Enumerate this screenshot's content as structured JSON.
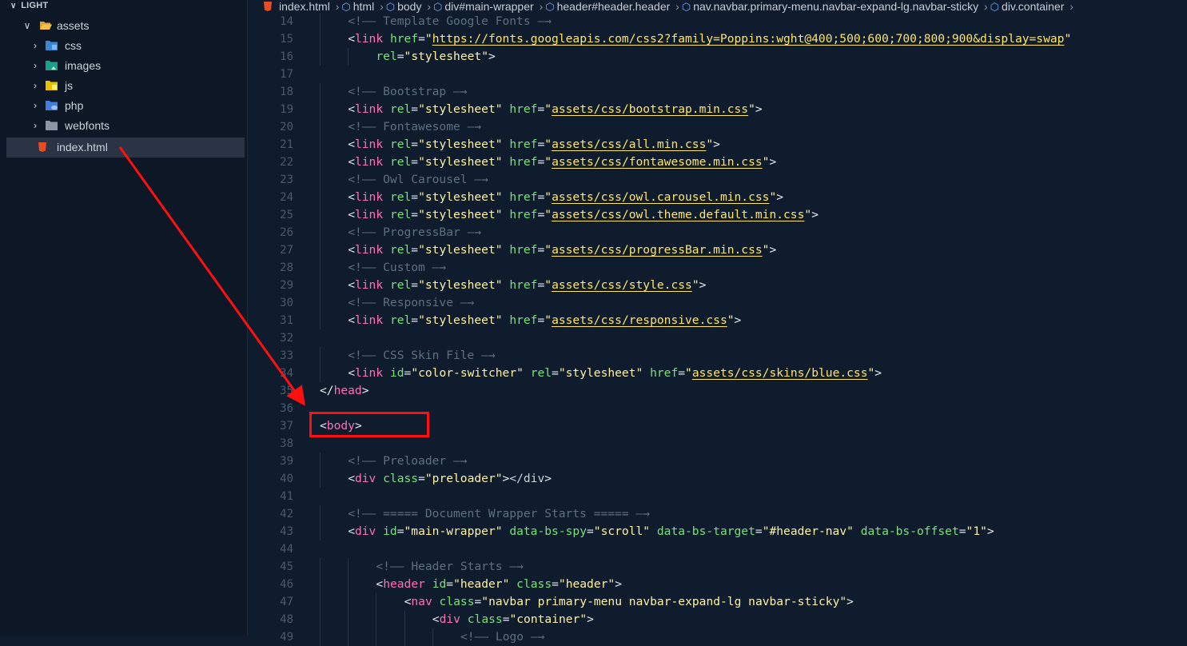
{
  "sidebar": {
    "title": "LIGHT",
    "items": [
      {
        "label": "assets",
        "icon": "folder-open-icon",
        "expanded": true
      },
      {
        "label": "css",
        "icon": "css-folder-icon"
      },
      {
        "label": "images",
        "icon": "images-folder-icon"
      },
      {
        "label": "js",
        "icon": "js-folder-icon"
      },
      {
        "label": "php",
        "icon": "php-folder-icon"
      },
      {
        "label": "webfonts",
        "icon": "folder-icon"
      },
      {
        "label": "index.html",
        "icon": "html5-icon",
        "selected": true
      }
    ]
  },
  "breadcrumb": {
    "file": "index.html",
    "items": [
      "html",
      "body",
      "div#main-wrapper",
      "header#header.header",
      "nav.navbar.primary-menu.navbar-expand-lg.navbar-sticky",
      "div.container"
    ]
  },
  "colors": {
    "background": "#0f1c2e",
    "sidebar_bg": "#0d1726",
    "tag": "#ff6fb5",
    "attribute": "#7be07b",
    "string": "#fff3a6",
    "comment": "#5c7080",
    "annotation": "#ff1010"
  },
  "editor": {
    "lines": [
      {
        "n": "14",
        "code": "<!-- Template Google Fonts -->"
      },
      {
        "n": "15",
        "code": "<link href=\"https://fonts.googleapis.com/css2?family=Poppins:wght@400;500;600;700;800;900&display=swap\""
      },
      {
        "n": "16",
        "code": "rel=\"stylesheet\">"
      },
      {
        "n": "17",
        "code": ""
      },
      {
        "n": "18",
        "code": "<!-- Bootstrap -->"
      },
      {
        "n": "19",
        "code": "<link rel=\"stylesheet\" href=\"assets/css/bootstrap.min.css\">"
      },
      {
        "n": "20",
        "code": "<!-- Fontawesome -->"
      },
      {
        "n": "21",
        "code": "<link rel=\"stylesheet\" href=\"assets/css/all.min.css\">"
      },
      {
        "n": "22",
        "code": "<link rel=\"stylesheet\" href=\"assets/css/fontawesome.min.css\">"
      },
      {
        "n": "23",
        "code": "<!-- Owl Carousel -->"
      },
      {
        "n": "24",
        "code": "<link rel=\"stylesheet\" href=\"assets/css/owl.carousel.min.css\">"
      },
      {
        "n": "25",
        "code": "<link rel=\"stylesheet\" href=\"assets/css/owl.theme.default.min.css\">"
      },
      {
        "n": "26",
        "code": "<!-- ProgressBar -->"
      },
      {
        "n": "27",
        "code": "<link rel=\"stylesheet\" href=\"assets/css/progressBar.min.css\">"
      },
      {
        "n": "28",
        "code": "<!-- Custom -->"
      },
      {
        "n": "29",
        "code": "<link rel=\"stylesheet\" href=\"assets/css/style.css\">"
      },
      {
        "n": "30",
        "code": "<!-- Responsive -->"
      },
      {
        "n": "31",
        "code": "<link rel=\"stylesheet\" href=\"assets/css/responsive.css\">"
      },
      {
        "n": "32",
        "code": ""
      },
      {
        "n": "33",
        "code": "<!-- CSS Skin File -->"
      },
      {
        "n": "34",
        "code": "<link id=\"color-switcher\" rel=\"stylesheet\" href=\"assets/css/skins/blue.css\">"
      },
      {
        "n": "35",
        "code": "</head>"
      },
      {
        "n": "36",
        "code": ""
      },
      {
        "n": "37",
        "code": "<body>"
      },
      {
        "n": "38",
        "code": ""
      },
      {
        "n": "39",
        "code": "<!-- Preloader -->"
      },
      {
        "n": "40",
        "code": "<div class=\"preloader\"></div>"
      },
      {
        "n": "41",
        "code": ""
      },
      {
        "n": "42",
        "code": "<!-- ===== Document Wrapper Starts ===== -->"
      },
      {
        "n": "43",
        "code": "<div id=\"main-wrapper\" data-bs-spy=\"scroll\" data-bs-target=\"#header-nav\" data-bs-offset=\"1\">"
      },
      {
        "n": "44",
        "code": ""
      },
      {
        "n": "45",
        "code": "<!-- Header Starts -->"
      },
      {
        "n": "46",
        "code": "<header id=\"header\" class=\"header\">"
      },
      {
        "n": "47",
        "code": "<nav class=\"navbar primary-menu navbar-expand-lg navbar-sticky\">"
      },
      {
        "n": "48",
        "code": "<div class=\"container\">"
      },
      {
        "n": "49",
        "code": "<!-- Logo -->"
      }
    ]
  }
}
